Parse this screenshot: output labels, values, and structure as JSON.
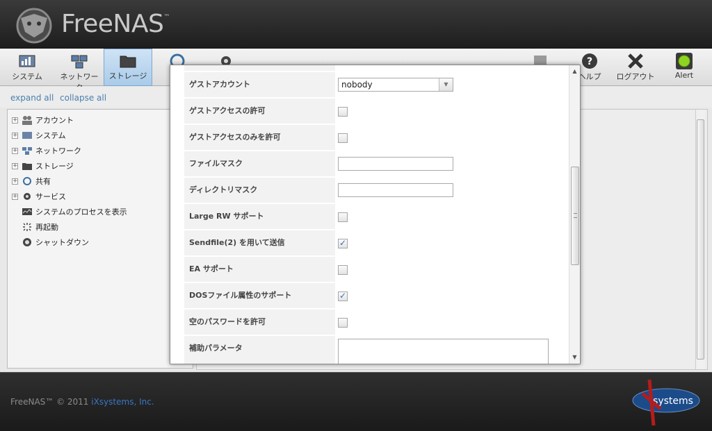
{
  "brand": {
    "name": "FreeNAS",
    "tm": "™"
  },
  "toolbar": {
    "system": "システム",
    "network": "ネットワーク",
    "storage": "ストレージ",
    "help": "ヘルプ",
    "logout": "ログアウト",
    "alert": "Alert"
  },
  "tree_controls": {
    "expand_all": "expand all",
    "collapse_all": "collapse all"
  },
  "tree": {
    "items": [
      {
        "label": "アカウント"
      },
      {
        "label": "システム"
      },
      {
        "label": "ネットワーク"
      },
      {
        "label": "ストレージ"
      },
      {
        "label": "共有"
      },
      {
        "label": "サービス"
      },
      {
        "label": "システムのプロセスを表示"
      },
      {
        "label": "再起動"
      },
      {
        "label": "シャットダウン"
      }
    ]
  },
  "form": {
    "guest_account": {
      "label": "ゲストアカウント",
      "value": "nobody"
    },
    "guest_access": {
      "label": "ゲストアクセスの許可",
      "checked": false
    },
    "guest_only": {
      "label": "ゲストアクセスのみを許可",
      "checked": false
    },
    "file_mask": {
      "label": "ファイルマスク",
      "value": ""
    },
    "dir_mask": {
      "label": "ディレクトリマスク",
      "value": ""
    },
    "large_rw": {
      "label": "Large RW サポート",
      "checked": false
    },
    "sendfile": {
      "label": "Sendfile(2) を用いて送信",
      "checked": true
    },
    "ea": {
      "label": "EA サポート",
      "checked": false
    },
    "dos_attrs": {
      "label": "DOSファイル属性のサポート",
      "checked": true
    },
    "empty_password": {
      "label": "空のパスワードを許可",
      "checked": false
    },
    "aux_params": {
      "label": "補助パラメータ",
      "value": ""
    }
  },
  "footer": {
    "copyright": "FreeNAS™ © 2011 ",
    "company": "iXsystems, Inc.",
    "logo_text": "systems"
  },
  "colors": {
    "accent": "#3a77c4",
    "header": "#262626",
    "active_tab": "#a9cbe9"
  }
}
